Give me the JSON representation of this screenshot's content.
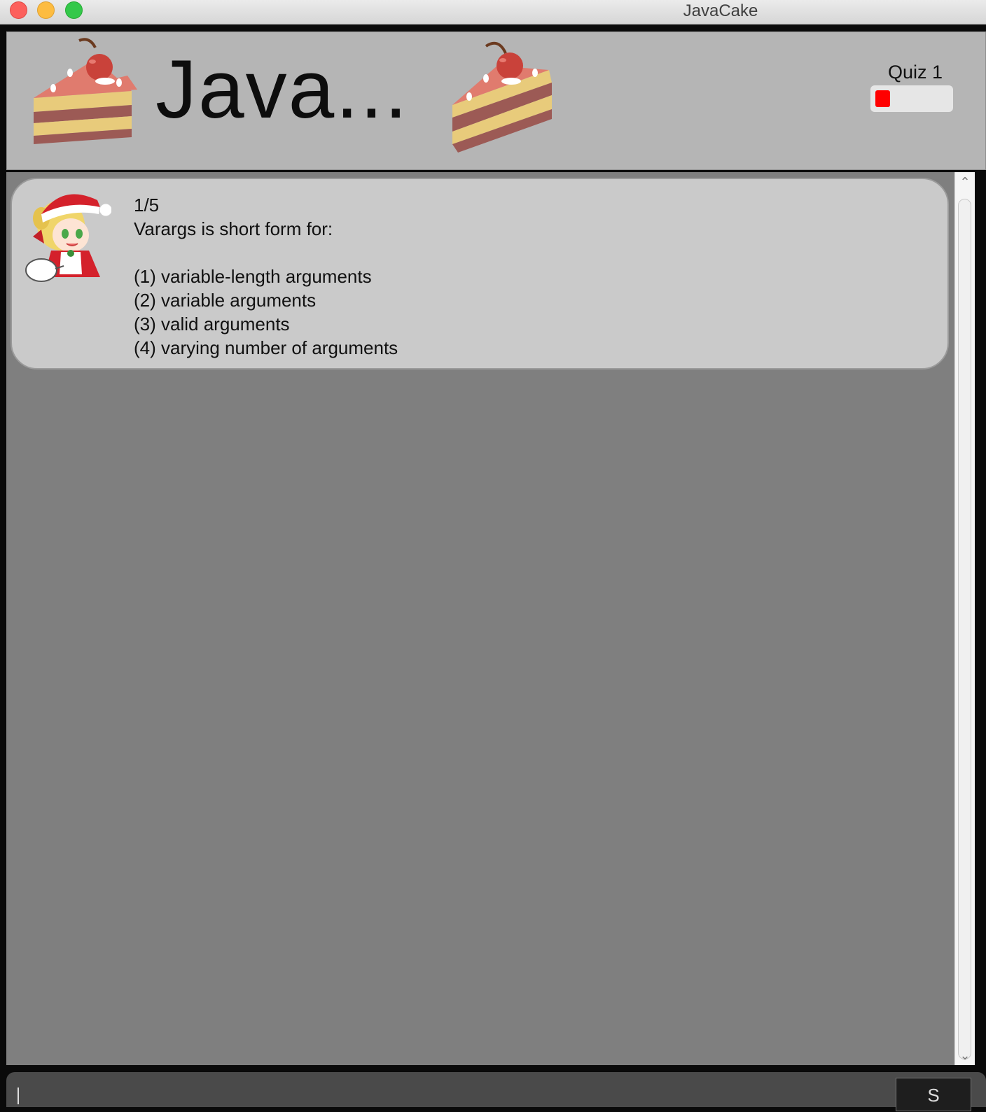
{
  "window": {
    "title": "JavaCake",
    "controls": [
      "close",
      "minimize",
      "zoom"
    ]
  },
  "header": {
    "title": "Java...",
    "left_icon": "cake-slice-icon",
    "right_icon": "cake-slice-icon",
    "quiz_label": "Quiz 1",
    "quiz_progress_fraction": 0.2,
    "quiz_progress_color": "#ff0000"
  },
  "dialog": {
    "avatar_icon": "santa-girl-avatar-icon",
    "counter": "1/5",
    "question": "Varargs is short form for:",
    "options": [
      "(1) variable-length arguments",
      "(2) variable arguments",
      "(3) valid arguments",
      "(4) varying number of arguments"
    ]
  },
  "input": {
    "value": "",
    "send_label": "S"
  },
  "colors": {
    "header_bg": "#b5b5b5",
    "dialog_bg": "#7f7f7f",
    "bubble_bg": "#cacaca",
    "input_bg": "#4a4a4a"
  }
}
